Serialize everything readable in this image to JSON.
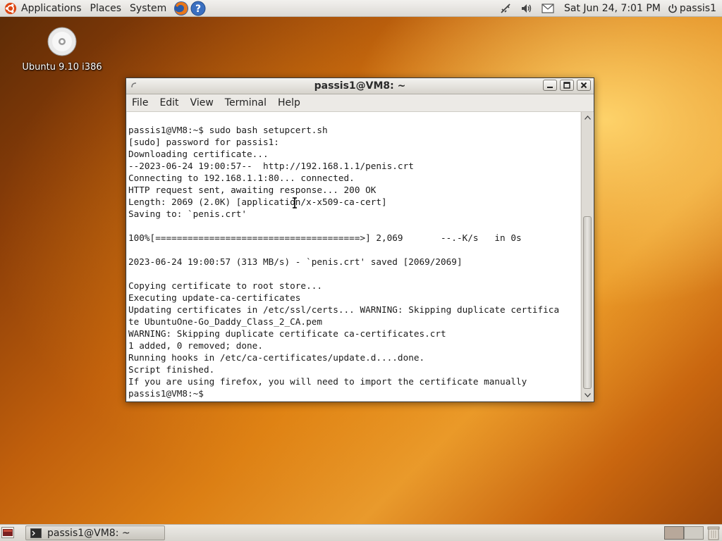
{
  "top_panel": {
    "menus": [
      "Applications",
      "Places",
      "System"
    ],
    "clock": "Sat Jun 24,  7:01 PM",
    "user": "passis1"
  },
  "desktop": {
    "icon_label": "Ubuntu 9.10 i386"
  },
  "terminal": {
    "title": "passis1@VM8: ~",
    "menu": [
      "File",
      "Edit",
      "View",
      "Terminal",
      "Help"
    ],
    "lines": [
      "passis1@VM8:~$ sudo bash setupcert.sh",
      "[sudo] password for passis1:",
      "Downloading certificate...",
      "--2023-06-24 19:00:57--  http://192.168.1.1/penis.crt",
      "Connecting to 192.168.1.1:80... connected.",
      "HTTP request sent, awaiting response... 200 OK",
      "Length: 2069 (2.0K) [application/x-x509-ca-cert]",
      "Saving to: `penis.crt'",
      "",
      "100%[======================================>] 2,069       --.-K/s   in 0s",
      "",
      "2023-06-24 19:00:57 (313 MB/s) - `penis.crt' saved [2069/2069]",
      "",
      "Copying certificate to root store...",
      "Executing update-ca-certificates",
      "Updating certificates in /etc/ssl/certs... WARNING: Skipping duplicate certifica",
      "te UbuntuOne-Go_Daddy_Class_2_CA.pem",
      "WARNING: Skipping duplicate certificate ca-certificates.crt",
      "1 added, 0 removed; done.",
      "Running hooks in /etc/ca-certificates/update.d....done.",
      "Script finished.",
      "If you are using firefox, you will need to import the certificate manually",
      "passis1@VM8:~$ "
    ]
  },
  "taskbar": {
    "task_label": "passis1@VM8: ~"
  }
}
